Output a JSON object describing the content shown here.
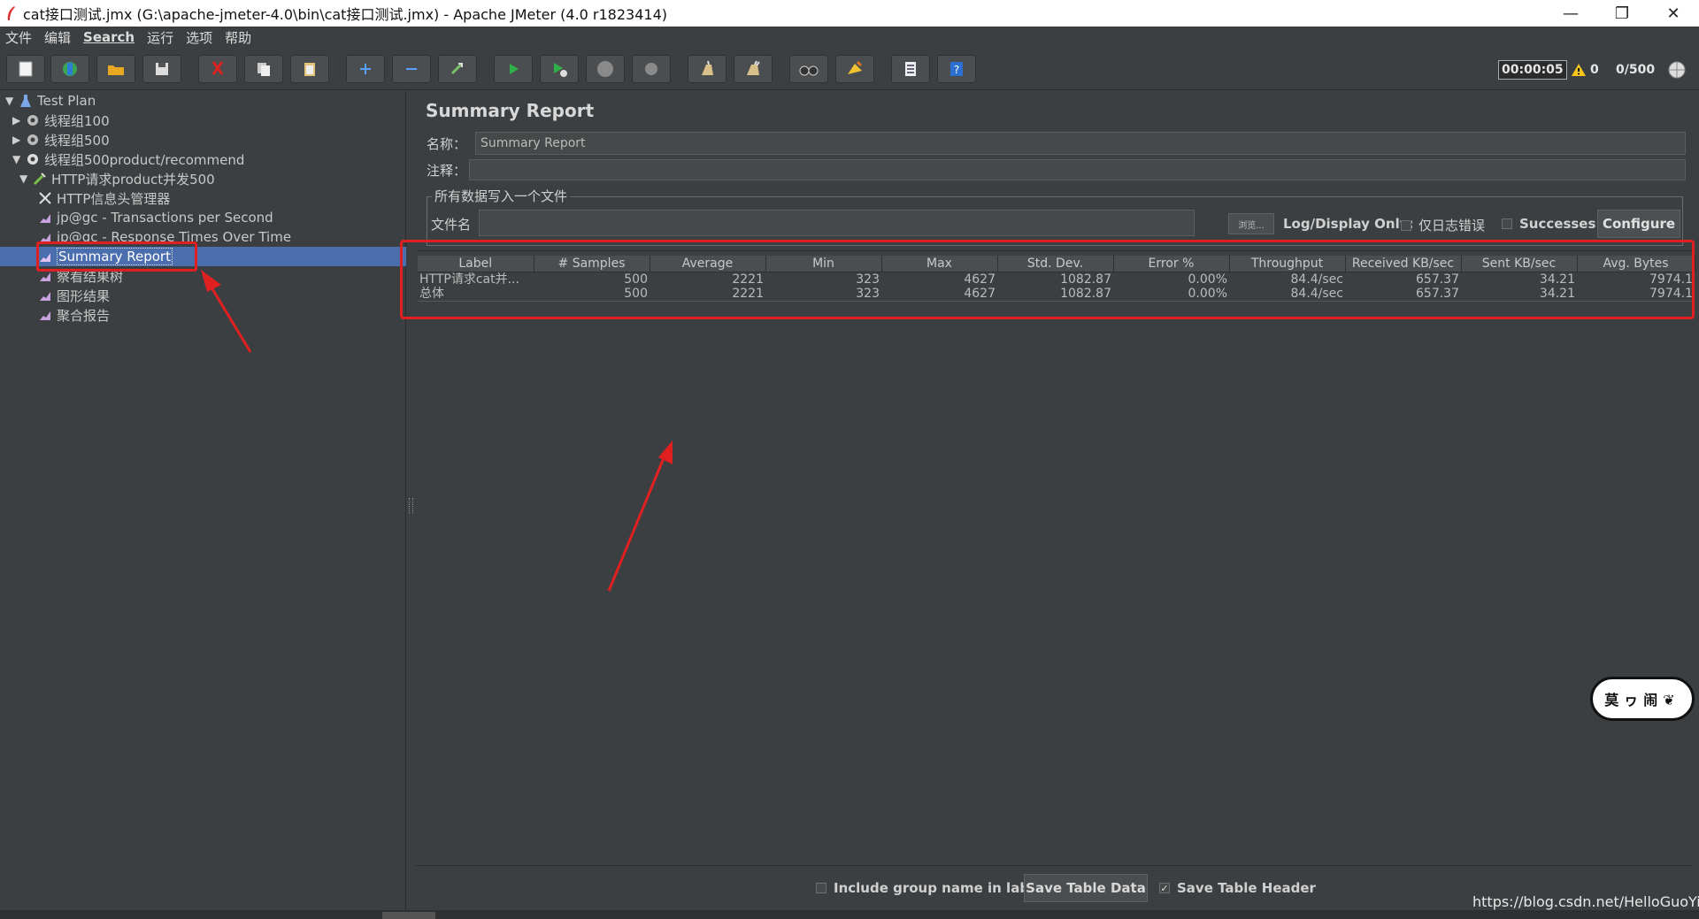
{
  "window": {
    "title": "cat接口测试.jmx (G:\\apache-jmeter-4.0\\bin\\cat接口测试.jmx) - Apache JMeter (4.0 r1823414)",
    "minimize": "—",
    "maximize": "❐",
    "close": "✕"
  },
  "menu": {
    "items": [
      "文件",
      "编辑",
      "Search",
      "运行",
      "选项",
      "帮助"
    ]
  },
  "toolbar": {
    "timer": "00:00:05",
    "warning_count": "0",
    "thread_count": "0/500"
  },
  "tree": {
    "items": [
      {
        "label": "Test Plan",
        "icon": "flask-icon"
      },
      {
        "label": "线程组100",
        "icon": "gear-icon"
      },
      {
        "label": "线程组500",
        "icon": "gear-icon"
      },
      {
        "label": "线程组500product/recommend",
        "icon": "gear-icon"
      },
      {
        "label": "HTTP请求product并发500",
        "icon": "pipette-icon"
      },
      {
        "label": "HTTP信息头管理器",
        "icon": "wrench-icon"
      },
      {
        "label": "jp@gc - Transactions per Second",
        "icon": "chart-icon"
      },
      {
        "label": "jp@gc - Response Times Over Time",
        "icon": "chart-icon"
      },
      {
        "label": "Summary Report",
        "icon": "chart-icon"
      },
      {
        "label": "察看结果树",
        "icon": "chart-icon"
      },
      {
        "label": "图形结果",
        "icon": "chart-icon"
      },
      {
        "label": "聚合报告",
        "icon": "chart-icon"
      }
    ]
  },
  "report": {
    "title": "Summary Report",
    "name_label": "名称：",
    "name_value": "Summary Report",
    "comment_label": "注释：",
    "comment_value": "",
    "file_group_title": "所有数据写入一个文件",
    "filename_label": "文件名",
    "filename_value": "",
    "browse_label": "浏览...",
    "log_display_label": "Log/Display Only:",
    "errors_only_label": "仅日志错误",
    "successes_label": "Successes",
    "configure_label": "Configure"
  },
  "table": {
    "columns": [
      "Label",
      "# Samples",
      "Average",
      "Min",
      "Max",
      "Std. Dev.",
      "Error %",
      "Throughput",
      "Received KB/sec",
      "Sent KB/sec",
      "Avg. Bytes"
    ],
    "rows": [
      [
        "HTTP请求cat并...",
        "500",
        "2221",
        "323",
        "4627",
        "1082.87",
        "0.00%",
        "84.4/sec",
        "657.37",
        "34.21",
        "7974.1"
      ],
      [
        "总体",
        "500",
        "2221",
        "323",
        "4627",
        "1082.87",
        "0.00%",
        "84.4/sec",
        "657.37",
        "34.21",
        "7974.1"
      ]
    ]
  },
  "bottom": {
    "include_group_label": "Include group name in label?",
    "save_table_data": "Save Table Data",
    "save_table_header": "Save Table Header",
    "save_table_header_checked": "✓"
  },
  "overlay": {
    "widget_text": "莫ヮ闹❦",
    "watermark": "https://blog.csdn.net/HelloGuoYing"
  },
  "colors": {
    "background": "#3c3f41",
    "selection": "#4b6eaf",
    "annotation_red": "#e02020"
  }
}
